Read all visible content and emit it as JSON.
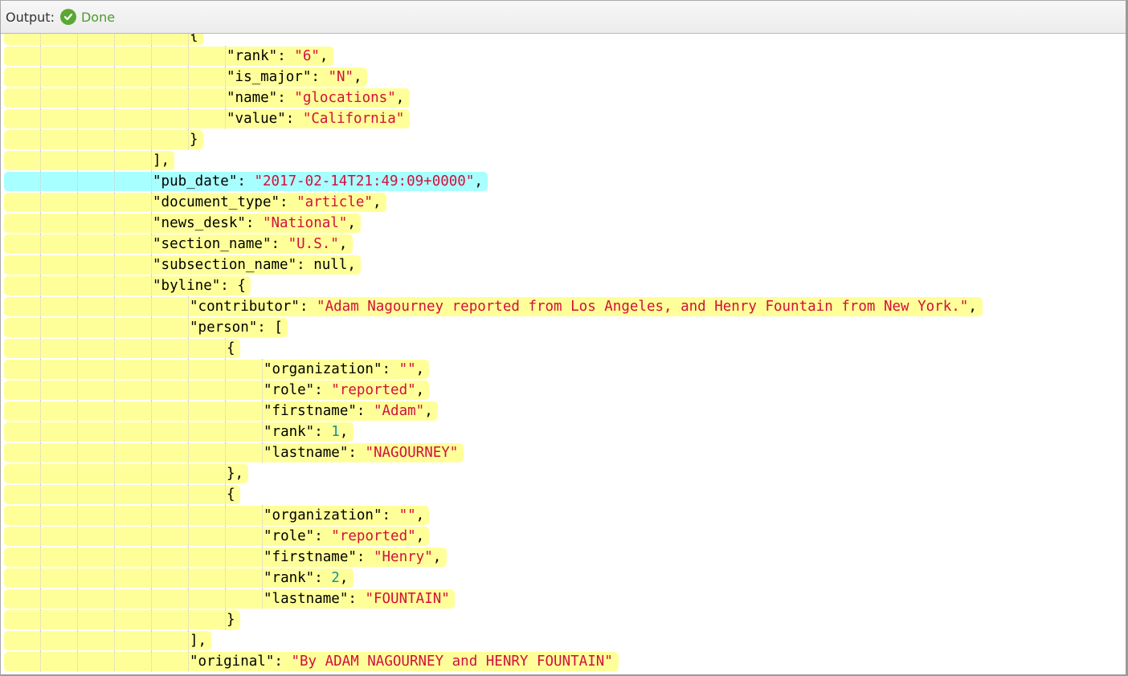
{
  "header": {
    "label": "Output:",
    "status_icon": "check-circle-icon",
    "status_text": "Done",
    "status_color": "#5aa832"
  },
  "colors": {
    "highlight": "#ffff99",
    "selected_line": "#a8ffff",
    "string": "#d1103c",
    "number": "#11939a"
  },
  "lines": [
    {
      "indent": 5,
      "parts": [
        [
          "p",
          "{"
        ]
      ],
      "hl": false,
      "partial": true
    },
    {
      "indent": 6,
      "parts": [
        [
          "k",
          "\"rank\""
        ],
        [
          "p",
          ": "
        ],
        [
          "s",
          "\"6\""
        ],
        [
          "p",
          ","
        ]
      ]
    },
    {
      "indent": 6,
      "parts": [
        [
          "k",
          "\"is_major\""
        ],
        [
          "p",
          ": "
        ],
        [
          "s",
          "\"N\""
        ],
        [
          "p",
          ","
        ]
      ]
    },
    {
      "indent": 6,
      "parts": [
        [
          "k",
          "\"name\""
        ],
        [
          "p",
          ": "
        ],
        [
          "s",
          "\"glocations\""
        ],
        [
          "p",
          ","
        ]
      ]
    },
    {
      "indent": 6,
      "parts": [
        [
          "k",
          "\"value\""
        ],
        [
          "p",
          ": "
        ],
        [
          "s",
          "\"California\""
        ]
      ]
    },
    {
      "indent": 5,
      "parts": [
        [
          "p",
          "}"
        ]
      ]
    },
    {
      "indent": 4,
      "parts": [
        [
          "p",
          "],"
        ]
      ]
    },
    {
      "indent": 4,
      "parts": [
        [
          "k",
          "\"pub_date\""
        ],
        [
          "p",
          ": "
        ],
        [
          "s",
          "\"2017-02-14T21:49:09+0000\""
        ],
        [
          "p",
          ","
        ]
      ],
      "selected": true
    },
    {
      "indent": 4,
      "parts": [
        [
          "k",
          "\"document_type\""
        ],
        [
          "p",
          ": "
        ],
        [
          "s",
          "\"article\""
        ],
        [
          "p",
          ","
        ]
      ]
    },
    {
      "indent": 4,
      "parts": [
        [
          "k",
          "\"news_desk\""
        ],
        [
          "p",
          ": "
        ],
        [
          "s",
          "\"National\""
        ],
        [
          "p",
          ","
        ]
      ]
    },
    {
      "indent": 4,
      "parts": [
        [
          "k",
          "\"section_name\""
        ],
        [
          "p",
          ": "
        ],
        [
          "s",
          "\"U.S.\""
        ],
        [
          "p",
          ","
        ]
      ]
    },
    {
      "indent": 4,
      "parts": [
        [
          "k",
          "\"subsection_name\""
        ],
        [
          "p",
          ": null,"
        ]
      ]
    },
    {
      "indent": 4,
      "parts": [
        [
          "k",
          "\"byline\""
        ],
        [
          "p",
          ": {"
        ]
      ]
    },
    {
      "indent": 5,
      "parts": [
        [
          "k",
          "\"contributor\""
        ],
        [
          "p",
          ": "
        ],
        [
          "s",
          "\"Adam Nagourney reported from Los Angeles, and Henry Fountain from New York.\""
        ],
        [
          "p",
          ","
        ]
      ]
    },
    {
      "indent": 5,
      "parts": [
        [
          "k",
          "\"person\""
        ],
        [
          "p",
          ": ["
        ]
      ]
    },
    {
      "indent": 6,
      "parts": [
        [
          "p",
          "{"
        ]
      ]
    },
    {
      "indent": 7,
      "parts": [
        [
          "k",
          "\"organization\""
        ],
        [
          "p",
          ": "
        ],
        [
          "s",
          "\"\""
        ],
        [
          "p",
          ","
        ]
      ]
    },
    {
      "indent": 7,
      "parts": [
        [
          "k",
          "\"role\""
        ],
        [
          "p",
          ": "
        ],
        [
          "s",
          "\"reported\""
        ],
        [
          "p",
          ","
        ]
      ]
    },
    {
      "indent": 7,
      "parts": [
        [
          "k",
          "\"firstname\""
        ],
        [
          "p",
          ": "
        ],
        [
          "s",
          "\"Adam\""
        ],
        [
          "p",
          ","
        ]
      ]
    },
    {
      "indent": 7,
      "parts": [
        [
          "k",
          "\"rank\""
        ],
        [
          "p",
          ": "
        ],
        [
          "n",
          "1"
        ],
        [
          "p",
          ","
        ]
      ]
    },
    {
      "indent": 7,
      "parts": [
        [
          "k",
          "\"lastname\""
        ],
        [
          "p",
          ": "
        ],
        [
          "s",
          "\"NAGOURNEY\""
        ]
      ]
    },
    {
      "indent": 6,
      "parts": [
        [
          "p",
          "},"
        ]
      ]
    },
    {
      "indent": 6,
      "parts": [
        [
          "p",
          "{"
        ]
      ]
    },
    {
      "indent": 7,
      "parts": [
        [
          "k",
          "\"organization\""
        ],
        [
          "p",
          ": "
        ],
        [
          "s",
          "\"\""
        ],
        [
          "p",
          ","
        ]
      ]
    },
    {
      "indent": 7,
      "parts": [
        [
          "k",
          "\"role\""
        ],
        [
          "p",
          ": "
        ],
        [
          "s",
          "\"reported\""
        ],
        [
          "p",
          ","
        ]
      ]
    },
    {
      "indent": 7,
      "parts": [
        [
          "k",
          "\"firstname\""
        ],
        [
          "p",
          ": "
        ],
        [
          "s",
          "\"Henry\""
        ],
        [
          "p",
          ","
        ]
      ]
    },
    {
      "indent": 7,
      "parts": [
        [
          "k",
          "\"rank\""
        ],
        [
          "p",
          ": "
        ],
        [
          "n",
          "2"
        ],
        [
          "p",
          ","
        ]
      ]
    },
    {
      "indent": 7,
      "parts": [
        [
          "k",
          "\"lastname\""
        ],
        [
          "p",
          ": "
        ],
        [
          "s",
          "\"FOUNTAIN\""
        ]
      ]
    },
    {
      "indent": 6,
      "parts": [
        [
          "p",
          "}"
        ]
      ]
    },
    {
      "indent": 5,
      "parts": [
        [
          "p",
          "],"
        ]
      ]
    },
    {
      "indent": 5,
      "parts": [
        [
          "k",
          "\"original\""
        ],
        [
          "p",
          ": "
        ],
        [
          "s",
          "\"By ADAM NAGOURNEY and HENRY FOUNTAIN\""
        ]
      ]
    }
  ]
}
